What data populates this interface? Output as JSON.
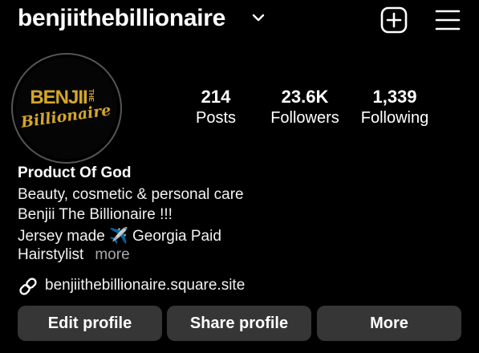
{
  "header": {
    "username": "benjiithebillionaire",
    "icons": {
      "dropdown": "chevron-down-icon",
      "create": "plus-square-icon",
      "menu": "hamburger-menu-icon"
    }
  },
  "avatar": {
    "logo_text_top": "BENJII",
    "logo_text_side": "THE",
    "logo_text_script": "Billionaire",
    "ring_color": "#555555",
    "logo_color": "#d4a62a"
  },
  "stats": [
    {
      "value": "214",
      "label": "Posts"
    },
    {
      "value": "23.6K",
      "label": "Followers"
    },
    {
      "value": "1,339",
      "label": "Following"
    }
  ],
  "bio": {
    "name": "Product Of God",
    "category": "Beauty, cosmetic & personal care",
    "line2": "Benjii The Billionaire !!!",
    "line3_text": "Jersey made",
    "line3_emoji": "✈️",
    "line3_after": "Georgia Paid",
    "line4": "Hairstylist",
    "more": "more"
  },
  "link": {
    "icon": "link-icon",
    "url": "benjiithebillionaire.square.site"
  },
  "buttons": {
    "edit": "Edit profile",
    "share": "Share profile",
    "more": "More"
  },
  "colors": {
    "background": "#000000",
    "button_bg": "#363636",
    "secondary_text": "#a8a8a8"
  }
}
